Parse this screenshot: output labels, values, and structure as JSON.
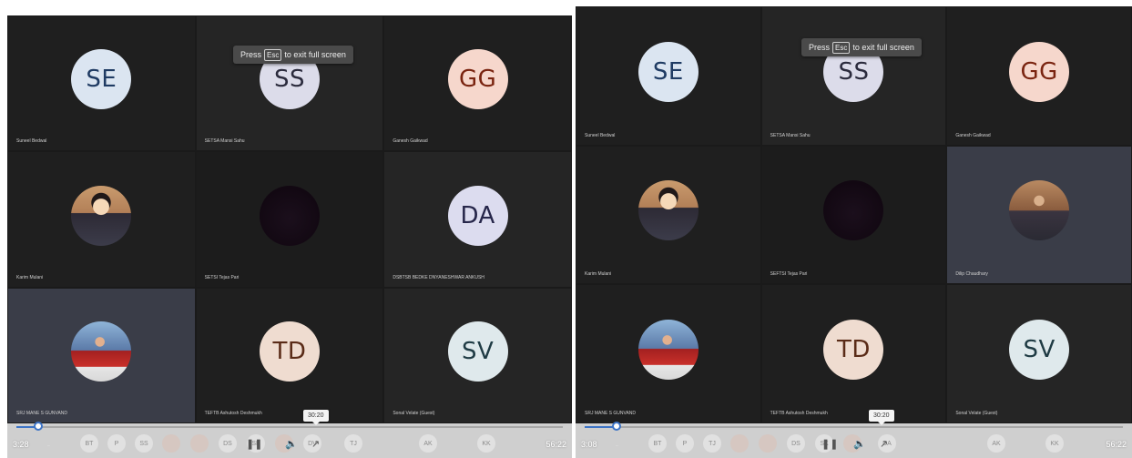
{
  "screens": [
    {
      "toast": {
        "before": "Press",
        "key": "Esc",
        "after": "to exit full screen"
      },
      "tiles": [
        {
          "initials": "SE",
          "name": "Suneel Bedwal"
        },
        {
          "initials": "SS",
          "name": "SETSA Mansi Sahu"
        },
        {
          "initials": "GG",
          "name": "Ganesh Gaikwad"
        },
        {
          "initials": "",
          "name": "Karim Mulani",
          "photo": "man-portrait"
        },
        {
          "initials": "",
          "name": "SETSI Tejas Pari"
        },
        {
          "initials": "DA",
          "name": "DSBTSB BEDKE DNYANESHWAR ANKUSH"
        },
        {
          "initials": "",
          "name": "SRJ MANE S GUNVAND",
          "photo": "stage-speaker"
        },
        {
          "initials": "TD",
          "name": "TEFTB Ashutosh Deshmukh"
        },
        {
          "initials": "SV",
          "name": "Sonal Velate (Guest)"
        }
      ],
      "player": {
        "current_time": "3:28",
        "total_time": "56:22",
        "tooltip_time": "30:20",
        "subtext": "...",
        "progress": 0.04,
        "chips": [
          "BT",
          "P",
          "SS",
          "",
          "",
          "DS",
          "SK",
          "",
          "DV",
          "TJ",
          "AK",
          "KK"
        ]
      }
    },
    {
      "toast": {
        "before": "Press",
        "key": "Esc",
        "after": "to exit full screen"
      },
      "tiles": [
        {
          "initials": "SE",
          "name": "Suneel Bedwal"
        },
        {
          "initials": "SS",
          "name": "SETSA Mansi Sahu"
        },
        {
          "initials": "GG",
          "name": "Ganesh Gaikwad"
        },
        {
          "initials": "",
          "name": "Karim Mulani",
          "photo": "man-portrait"
        },
        {
          "initials": "",
          "name": "SEFTSI Tejas Pari"
        },
        {
          "initials": "",
          "name": "Dilip Chaudhary",
          "photo": "office-portrait"
        },
        {
          "initials": "",
          "name": "SRJ MANE S GUNVAND",
          "photo": "stage-speaker"
        },
        {
          "initials": "TD",
          "name": "TEFTB Ashutosh Deshmukh"
        },
        {
          "initials": "SV",
          "name": "Sonal Velate (Guest)"
        }
      ],
      "player": {
        "current_time": "3:08",
        "total_time": "56:22",
        "tooltip_time": "30:20",
        "subtext": "...",
        "progress": 0.06,
        "chips": [
          "BT",
          "P",
          "TJ",
          "",
          "",
          "DS",
          "SK",
          "",
          "DA",
          "",
          "AK",
          "KK"
        ]
      }
    }
  ]
}
